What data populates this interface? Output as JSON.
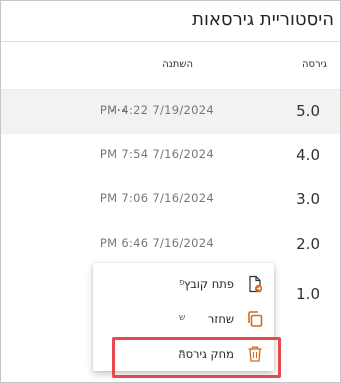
{
  "panel": {
    "title": "היסטוריית גירסאות"
  },
  "columns": {
    "version": "גירסה",
    "modified": "השתנה"
  },
  "rows": [
    {
      "version": "5.0",
      "modified": "7/19/2024 4:22 PM",
      "selected": true,
      "more_label": "..."
    },
    {
      "version": "4.0",
      "modified": "7/16/2024 7:54 PM"
    },
    {
      "version": "3.0",
      "modified": "7/16/2024 7:06 PM"
    },
    {
      "version": "2.0",
      "modified": "7/16/2024 6:46 PM"
    },
    {
      "version": "1.0",
      "modified": ""
    }
  ],
  "context_menu": {
    "items": [
      {
        "label": "פתח קובץ",
        "hint": "פ",
        "icon": "open-file-icon"
      },
      {
        "label": "שחזר",
        "hint": "ש",
        "icon": "restore-icon"
      },
      {
        "label": "מחק גירסה",
        "hint": "מ",
        "icon": "delete-icon",
        "highlighted": true
      }
    ]
  },
  "colors": {
    "accent": "#e5484d",
    "icon_orange": "#d2691e",
    "text": "#323130",
    "muted": "#797775"
  }
}
